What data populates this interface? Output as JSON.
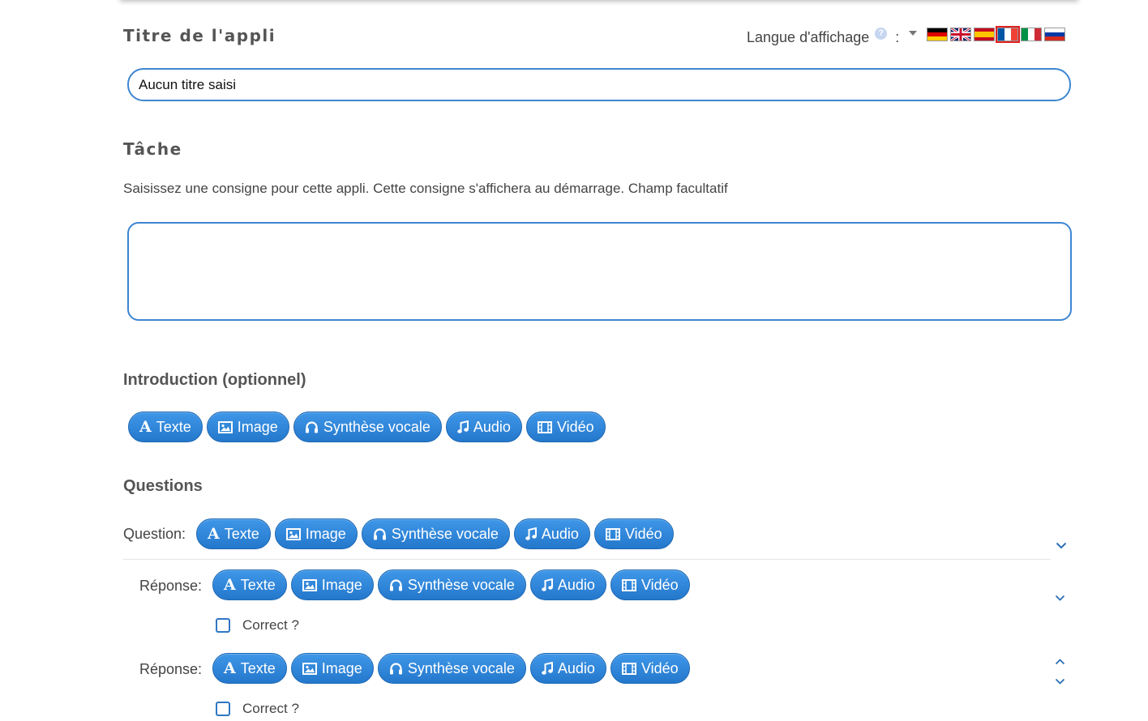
{
  "title_section": {
    "heading": "Titre de l'appli",
    "input_value": "Aucun titre saisi"
  },
  "language": {
    "label": "Langue d'affichage",
    "help": "?",
    "colon": ":",
    "flags": [
      "de",
      "en",
      "es",
      "fr",
      "it",
      "ru"
    ],
    "selected": "fr"
  },
  "task": {
    "heading": "Tâche",
    "description": "Saisissez une consigne pour cette appli. Cette consigne s'affichera au démarrage. Champ facultatif",
    "textarea_value": ""
  },
  "introduction": {
    "heading": "Introduction (optionnel)"
  },
  "media_buttons": {
    "text": "Texte",
    "image": "Image",
    "tts": "Synthèse vocale",
    "audio": "Audio",
    "video": "Vidéo"
  },
  "questions": {
    "heading": "Questions",
    "question_label": "Question:",
    "answers": [
      {
        "label": "Réponse:",
        "correct_label": "Correct ?",
        "correct": false
      },
      {
        "label": "Réponse:",
        "correct_label": "Correct ?",
        "correct": false
      }
    ]
  },
  "colors": {
    "accent": "#3d86d1",
    "button": "#2f86dc",
    "heading": "#555555"
  },
  "icons": {
    "text": "text-format-icon",
    "image": "image-icon",
    "tts": "headphones-icon",
    "audio": "music-note-icon",
    "video": "film-icon",
    "collapse": "chevron-down-icon",
    "move_up": "chevron-up-icon"
  }
}
